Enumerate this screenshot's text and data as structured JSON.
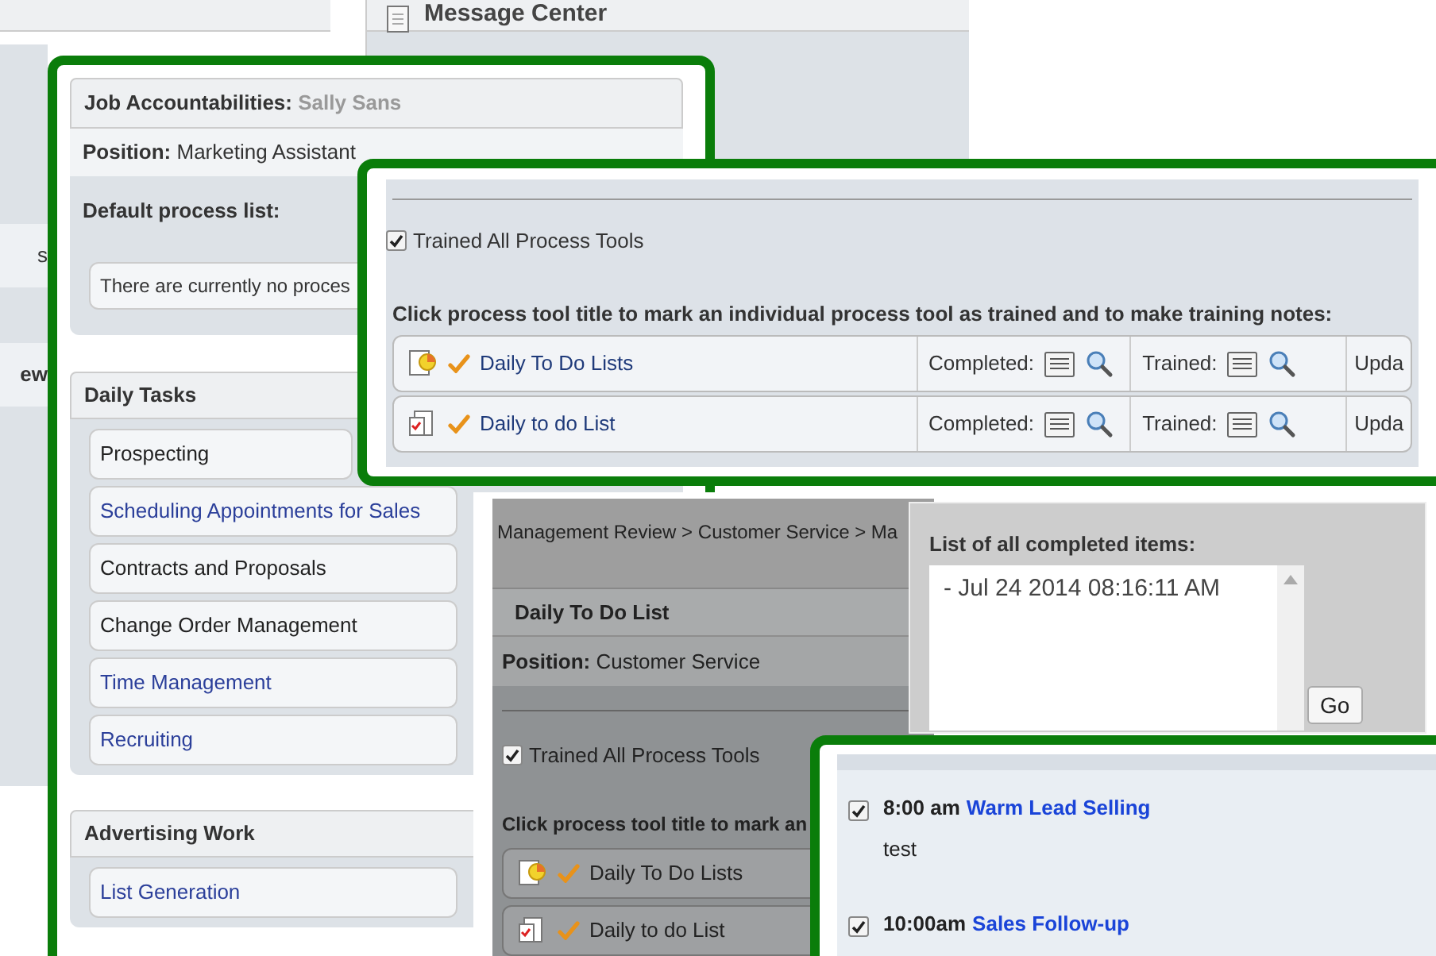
{
  "background": {
    "left_fragments": [
      "s",
      "ew"
    ],
    "message_center": {
      "title": "Message Center"
    }
  },
  "job_panel": {
    "title_label": "Job Accountabilities:",
    "person": "Sally Sans",
    "position_label": "Position:",
    "position": "Marketing Assistant",
    "default_list_label": "Default process list:",
    "default_list_message": "There are currently no proces",
    "groups": [
      {
        "title": "Daily Tasks",
        "items": [
          {
            "label": "Prospecting",
            "kind": "plain"
          },
          {
            "label": "Scheduling Appointments for Sales",
            "kind": "link"
          },
          {
            "label": "Contracts and Proposals",
            "kind": "plain"
          },
          {
            "label": "Change Order Management",
            "kind": "plain"
          },
          {
            "label": "Time Management",
            "kind": "link"
          },
          {
            "label": "Recruiting",
            "kind": "link"
          }
        ]
      },
      {
        "title": "Advertising Work",
        "items": [
          {
            "label": "List Generation",
            "kind": "link"
          }
        ]
      }
    ]
  },
  "tools_panel": {
    "trained_all": {
      "label": "Trained All Process Tools",
      "checked": true
    },
    "instruction": "Click process tool title to mark an individual process tool as trained and to make training notes:",
    "rows": [
      {
        "title": "Daily To Do Lists",
        "kind": "chart",
        "completed_label": "Completed:",
        "trained_label": "Trained:",
        "column_4": "Upda"
      },
      {
        "title": "Daily to do List",
        "kind": "checklist",
        "completed_label": "Completed:",
        "trained_label": "Trained:",
        "column_4": "Upda"
      }
    ]
  },
  "review_panel": {
    "breadcrumb": "Management Review > Customer Service > Ma",
    "title": "Daily To Do List",
    "position_label": "Position:",
    "position": "Customer Service",
    "trained_all": {
      "label": "Trained All Process Tools",
      "checked": true
    },
    "instruction": "Click process tool title to mark an",
    "rows": [
      {
        "title": "Daily To Do Lists",
        "kind": "chart"
      },
      {
        "title": "Daily to do List",
        "kind": "checklist"
      }
    ]
  },
  "completed_popup": {
    "label": "List of all completed items:",
    "items": [
      "- Jul 24 2014 08:16:11 AM"
    ],
    "button": "Go"
  },
  "schedule_panel": {
    "items": [
      {
        "checked": true,
        "time": "8:00 am",
        "title": "Warm Lead Selling",
        "note": "test"
      },
      {
        "checked": true,
        "time": "10:00am",
        "title": "Sales Follow-up"
      }
    ]
  }
}
